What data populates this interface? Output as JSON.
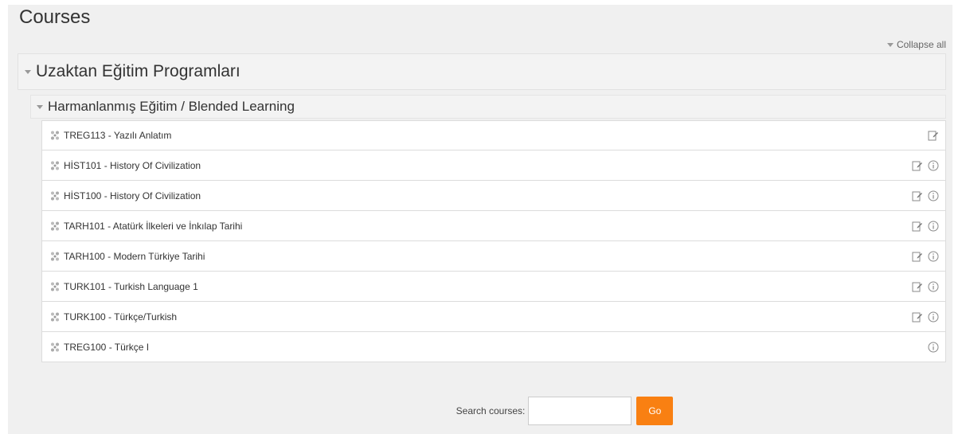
{
  "page": {
    "title": "Courses"
  },
  "toolbar": {
    "collapse_all": "Collapse all"
  },
  "category": {
    "name": "Uzaktan Eğitim Programları",
    "subcategory": {
      "name": "Harmanlanmış Eğitim / Blended Learning",
      "courses": [
        {
          "name": "TREG113 - Yazılı Anlatım",
          "edit": true,
          "info": false
        },
        {
          "name": "HİST101 - History Of Civilization",
          "edit": true,
          "info": true
        },
        {
          "name": "HİST100 - History Of Civilization",
          "edit": true,
          "info": true
        },
        {
          "name": "TARH101 - Atatürk İlkeleri ve İnkılap Tarihi",
          "edit": true,
          "info": true
        },
        {
          "name": "TARH100 - Modern Türkiye Tarihi",
          "edit": true,
          "info": true
        },
        {
          "name": "TURK101 - Turkish Language 1",
          "edit": true,
          "info": true
        },
        {
          "name": "TURK100 - Türkçe/Turkish",
          "edit": true,
          "info": true
        },
        {
          "name": "TREG100 - Türkçe I",
          "edit": false,
          "info": true
        }
      ]
    }
  },
  "search": {
    "label": "Search courses:",
    "value": "",
    "button": "Go"
  },
  "colors": {
    "accent": "#f98012",
    "panel": "#f0f0f0"
  },
  "icons": {
    "course": "course-icon",
    "edit": "enrol-edit-icon",
    "info": "info-icon",
    "collapse": "triangle-down-icon"
  }
}
